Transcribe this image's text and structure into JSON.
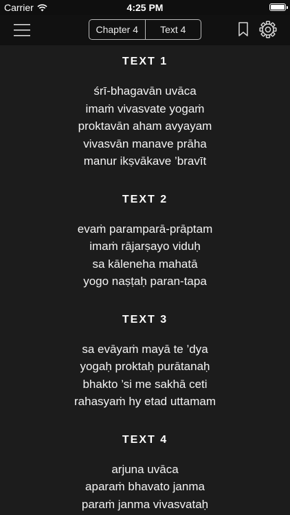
{
  "status_bar": {
    "carrier": "Carrier",
    "time": "4:25 PM",
    "battery_level": 1.0,
    "wifi_icon": "wifi-icon",
    "battery_icon": "battery-icon"
  },
  "nav_bar": {
    "menu_icon": "menu-icon",
    "segments": [
      {
        "label": "Chapter 4"
      },
      {
        "label": "Text 4"
      }
    ],
    "bookmark_icon": "bookmark-icon",
    "settings_icon": "gear-icon"
  },
  "sections": [
    {
      "heading": "TEXT 1",
      "lines": [
        "śrī-bhagavān uvāca",
        "imaṁ vivasvate yogaṁ",
        "proktavān aham avyayam",
        "vivasvān manave prāha",
        "manur ikṣvākave ’bravīt"
      ]
    },
    {
      "heading": "TEXT 2",
      "lines": [
        "evaṁ paramparā-prāptam",
        "imaṁ rājarṣayo viduḥ",
        "sa kāleneha mahatā",
        "yogo naṣṭaḥ paran-tapa"
      ]
    },
    {
      "heading": "TEXT 3",
      "lines": [
        "sa evāyaṁ mayā te ’dya",
        "yogaḥ proktaḥ purātanaḥ",
        "bhakto ’si me sakhā ceti",
        "rahasyaṁ hy etad uttamam"
      ]
    },
    {
      "heading": "TEXT 4",
      "lines": [
        "arjuna uvāca",
        "aparaṁ bhavato janma",
        "paraṁ janma vivasvataḥ"
      ]
    }
  ]
}
